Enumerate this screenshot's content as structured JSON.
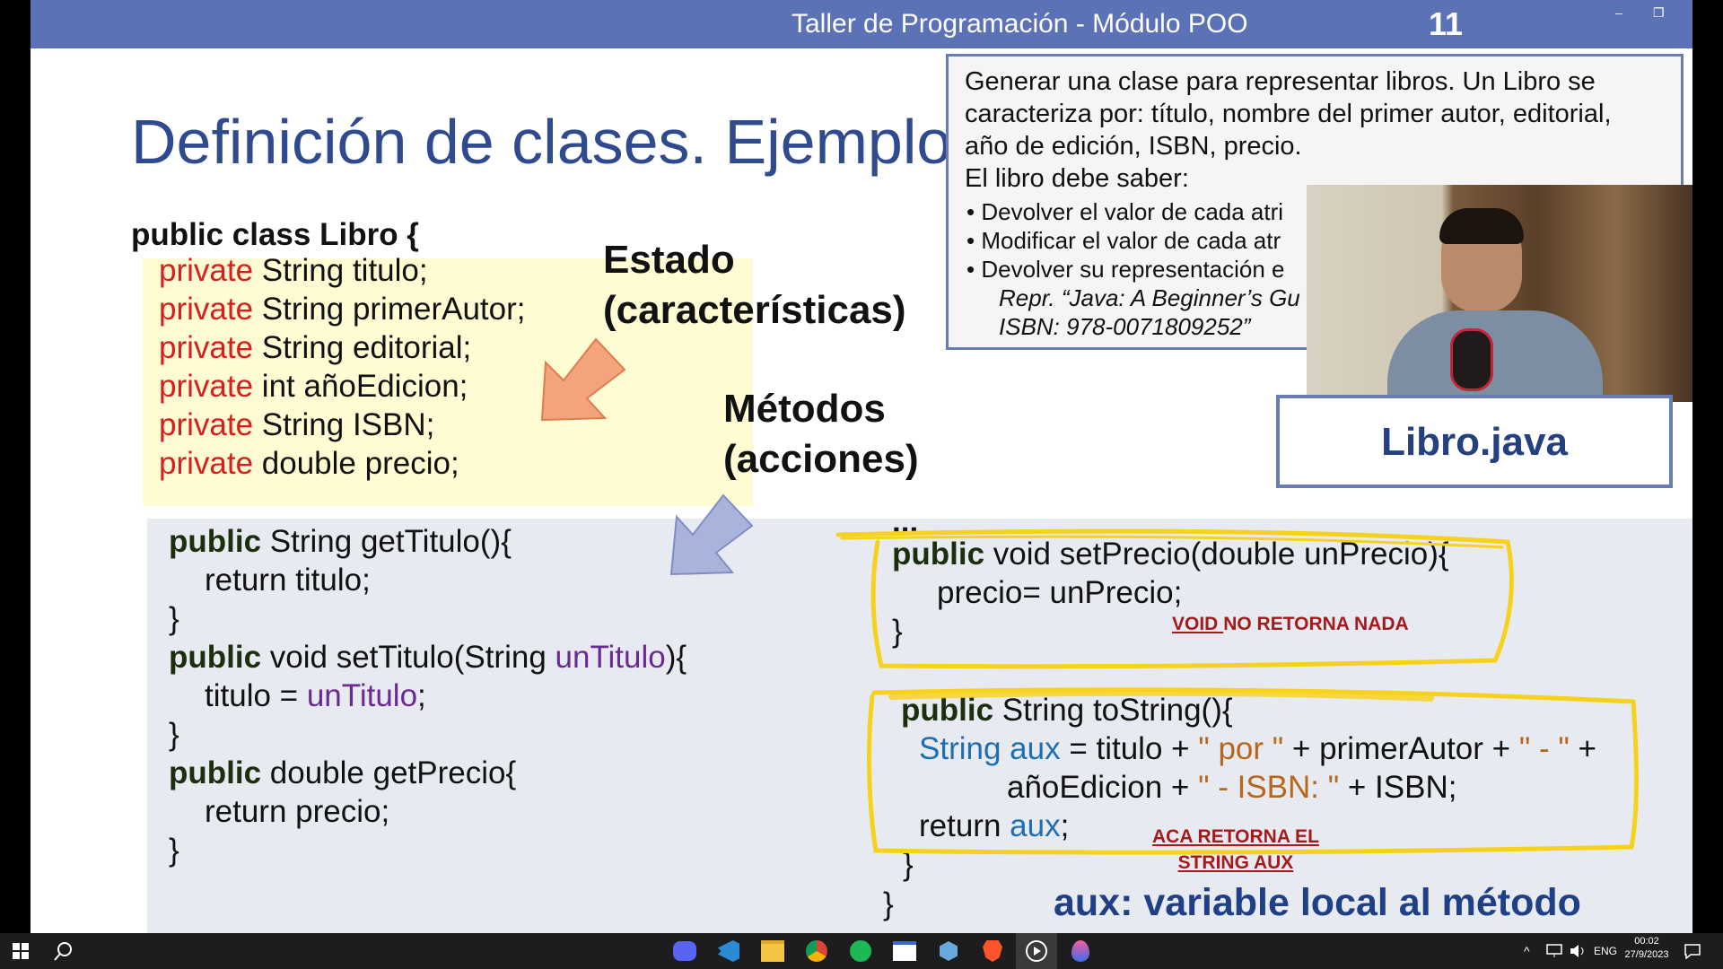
{
  "window": {
    "header_title": "Taller de Programación - Módulo POO",
    "slide_number": "11",
    "minimize": "–",
    "restore": "❐"
  },
  "slide": {
    "title": "Definición de clases. Ejemplo",
    "class_decl": "public class Libro {",
    "fields": [
      {
        "kw": "private",
        "rest": " String titulo;"
      },
      {
        "kw": "private",
        "rest": " String primerAutor;"
      },
      {
        "kw": "private",
        "rest": " String editorial;"
      },
      {
        "kw": "private",
        "rest": " int añoEdicion;"
      },
      {
        "kw": "private",
        "rest": " String ISBN;"
      },
      {
        "kw": "private",
        "rest": " double precio;"
      }
    ],
    "estado_heading": [
      "Estado",
      "(características)"
    ],
    "metodos_heading": [
      "Métodos",
      "(acciones)"
    ],
    "left_methods": {
      "kw": "public",
      "get_titulo_sig": " String getTitulo(){",
      "get_titulo_body": "return titulo;",
      "close": "}",
      "set_titulo_sig": " void setTitulo(String ",
      "set_titulo_param": "unTitulo",
      "set_titulo_end": "){",
      "set_titulo_body_a": "titulo = ",
      "set_titulo_body_param": "unTitulo",
      "set_titulo_body_end": ";",
      "get_precio_sig": " double getPrecio{",
      "get_precio_body": "return precio;"
    },
    "right_methods": {
      "ellipsis": "...",
      "set_precio_sig": " void setPrecio(double unPrecio){",
      "set_precio_body": "precio= unPrecio;",
      "to_string_sig": " String toString(){",
      "to_string_line1": [
        "String aux",
        " = titulo + ",
        "\" por \"",
        " + primerAutor + ",
        "\" - \"",
        " +"
      ],
      "to_string_line2": [
        "añoEdicion + ",
        "\" -  ISBN: \"",
        " + ISBN;"
      ],
      "to_string_return": [
        "return ",
        "aux",
        ";"
      ],
      "close": "}"
    },
    "description": {
      "lines": [
        "Generar una clase para representar libros. Un Libro se",
        "caracteriza por: título, nombre del primer autor, editorial,",
        "año de edición, ISBN, precio.",
        "El libro debe saber:"
      ],
      "bullets": [
        "•  Devolver el valor de cada atri",
        "•  Modificar el valor de cada atr",
        "•  Devolver su representación e"
      ],
      "italic_lines": [
        "Repr. “Java: A Beginner’s Gu",
        "ISBN: 978-0071809252”"
      ]
    },
    "file_label": "Libro.java",
    "annotations": {
      "void_note_underlined": "VOID ",
      "void_note_rest": "NO RETORNA NADA",
      "return_note": [
        "ACA RETORNA EL",
        "STRING AUX"
      ],
      "aux_note": "aux: variable local al método"
    },
    "colors": {
      "header": "#5b73b6",
      "title": "#2f4a8f",
      "keyword": "#d81d1d",
      "highlight": "#f7d21c",
      "estado_arrow": "#f4a47c",
      "metodos_arrow": "#a9b3dc"
    }
  },
  "taskbar": {
    "icons": [
      "windows-start-icon",
      "search-icon",
      "discord-icon",
      "vscode-icon",
      "file-explorer-icon",
      "chrome-icon",
      "spotify-icon",
      "window-icon",
      "cube-icon",
      "brave-icon",
      "media-player-icon",
      "drop-icon"
    ],
    "tray": {
      "chevron": "^",
      "language": "ENG",
      "time": "00:02",
      "date": "27/9/2023"
    }
  }
}
